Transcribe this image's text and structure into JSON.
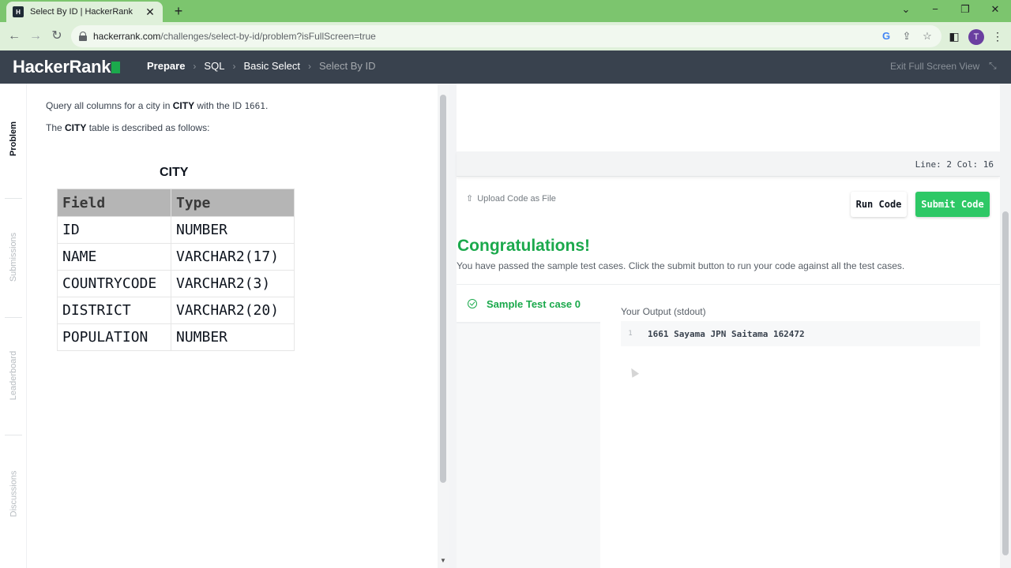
{
  "browser": {
    "tab_title": "Select By ID | HackerRank",
    "favicon_text": "H",
    "url_host": "hackerrank.com",
    "url_path": "/challenges/select-by-id/problem?isFullScreen=true",
    "avatar_letter": "T"
  },
  "header": {
    "logo": "HackerRank",
    "breadcrumbs": [
      "Prepare",
      "SQL",
      "Basic Select",
      "Select By ID"
    ],
    "exit_fullscreen": "Exit Full Screen View"
  },
  "side_tabs": [
    "Problem",
    "Submissions",
    "Leaderboard",
    "Discussions"
  ],
  "problem": {
    "line1_pre": "Query all columns for a city in ",
    "line1_table": "CITY",
    "line1_mid": " with the ID ",
    "line1_id": "1661",
    "line1_end": ".",
    "line2_pre": "The ",
    "line2_table": "CITY",
    "line2_post": " table is described as follows:",
    "table_title": "CITY",
    "columns": [
      "Field",
      "Type"
    ],
    "rows": [
      [
        "ID",
        "NUMBER"
      ],
      [
        "NAME",
        "VARCHAR2(17)"
      ],
      [
        "COUNTRYCODE",
        "VARCHAR2(3)"
      ],
      [
        "DISTRICT",
        "VARCHAR2(20)"
      ],
      [
        "POPULATION",
        "NUMBER"
      ]
    ]
  },
  "editor": {
    "status": "Line: 2 Col: 16",
    "upload_label": "Upload Code as File",
    "run_label": "Run Code",
    "submit_label": "Submit Code"
  },
  "result": {
    "heading": "Congratulations!",
    "message": "You have passed the sample test cases. Click the submit button to run your code against all the test cases.",
    "testcase_label": "Sample Test case 0",
    "output_label": "Your Output (stdout)",
    "output_line_no": "1",
    "output_value": "1661 Sayama JPN Saitama 162472"
  },
  "colors": {
    "accent_green": "#1ba94c",
    "submit_green": "#2ec866",
    "header_bg": "#39424e",
    "chrome_green": "#7cc56e"
  }
}
